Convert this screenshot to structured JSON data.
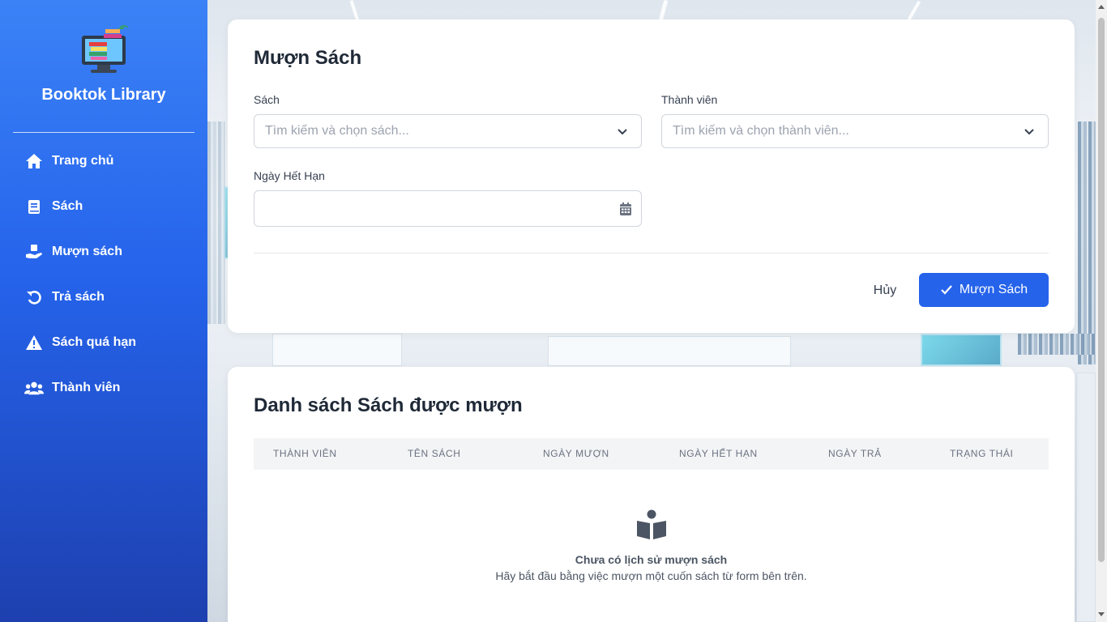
{
  "sidebar": {
    "brand": "Booktok Library",
    "items": [
      {
        "label": "Trang chủ",
        "icon": "home-icon"
      },
      {
        "label": "Sách",
        "icon": "book-icon"
      },
      {
        "label": "Mượn sách",
        "icon": "hand-book-icon"
      },
      {
        "label": "Trả sách",
        "icon": "undo-icon"
      },
      {
        "label": "Sách quá hạn",
        "icon": "warning-icon"
      },
      {
        "label": "Thành viên",
        "icon": "users-icon"
      }
    ]
  },
  "borrow_form": {
    "title": "Mượn Sách",
    "book_label": "Sách",
    "book_placeholder": "Tìm kiếm và chọn sách...",
    "member_label": "Thành viên",
    "member_placeholder": "Tìm kiếm và chọn thành viên...",
    "due_date_label": "Ngày Hết Hạn",
    "due_date_value": "",
    "cancel_label": "Hủy",
    "submit_label": "Mượn Sách"
  },
  "borrowed_list": {
    "title": "Danh sách Sách được mượn",
    "columns": [
      "Thành viên",
      "Tên sách",
      "Ngày mượn",
      "Ngày hết hạn",
      "Ngày trả",
      "Trạng thái"
    ],
    "rows": [],
    "empty_title": "Chưa có lịch sử mượn sách",
    "empty_subtitle": "Hãy bắt đầu bằng việc mượn một cuốn sách từ form bên trên."
  },
  "colors": {
    "primary": "#2563eb",
    "sidebar_top": "#3b82f6",
    "sidebar_bottom": "#1e40af"
  }
}
